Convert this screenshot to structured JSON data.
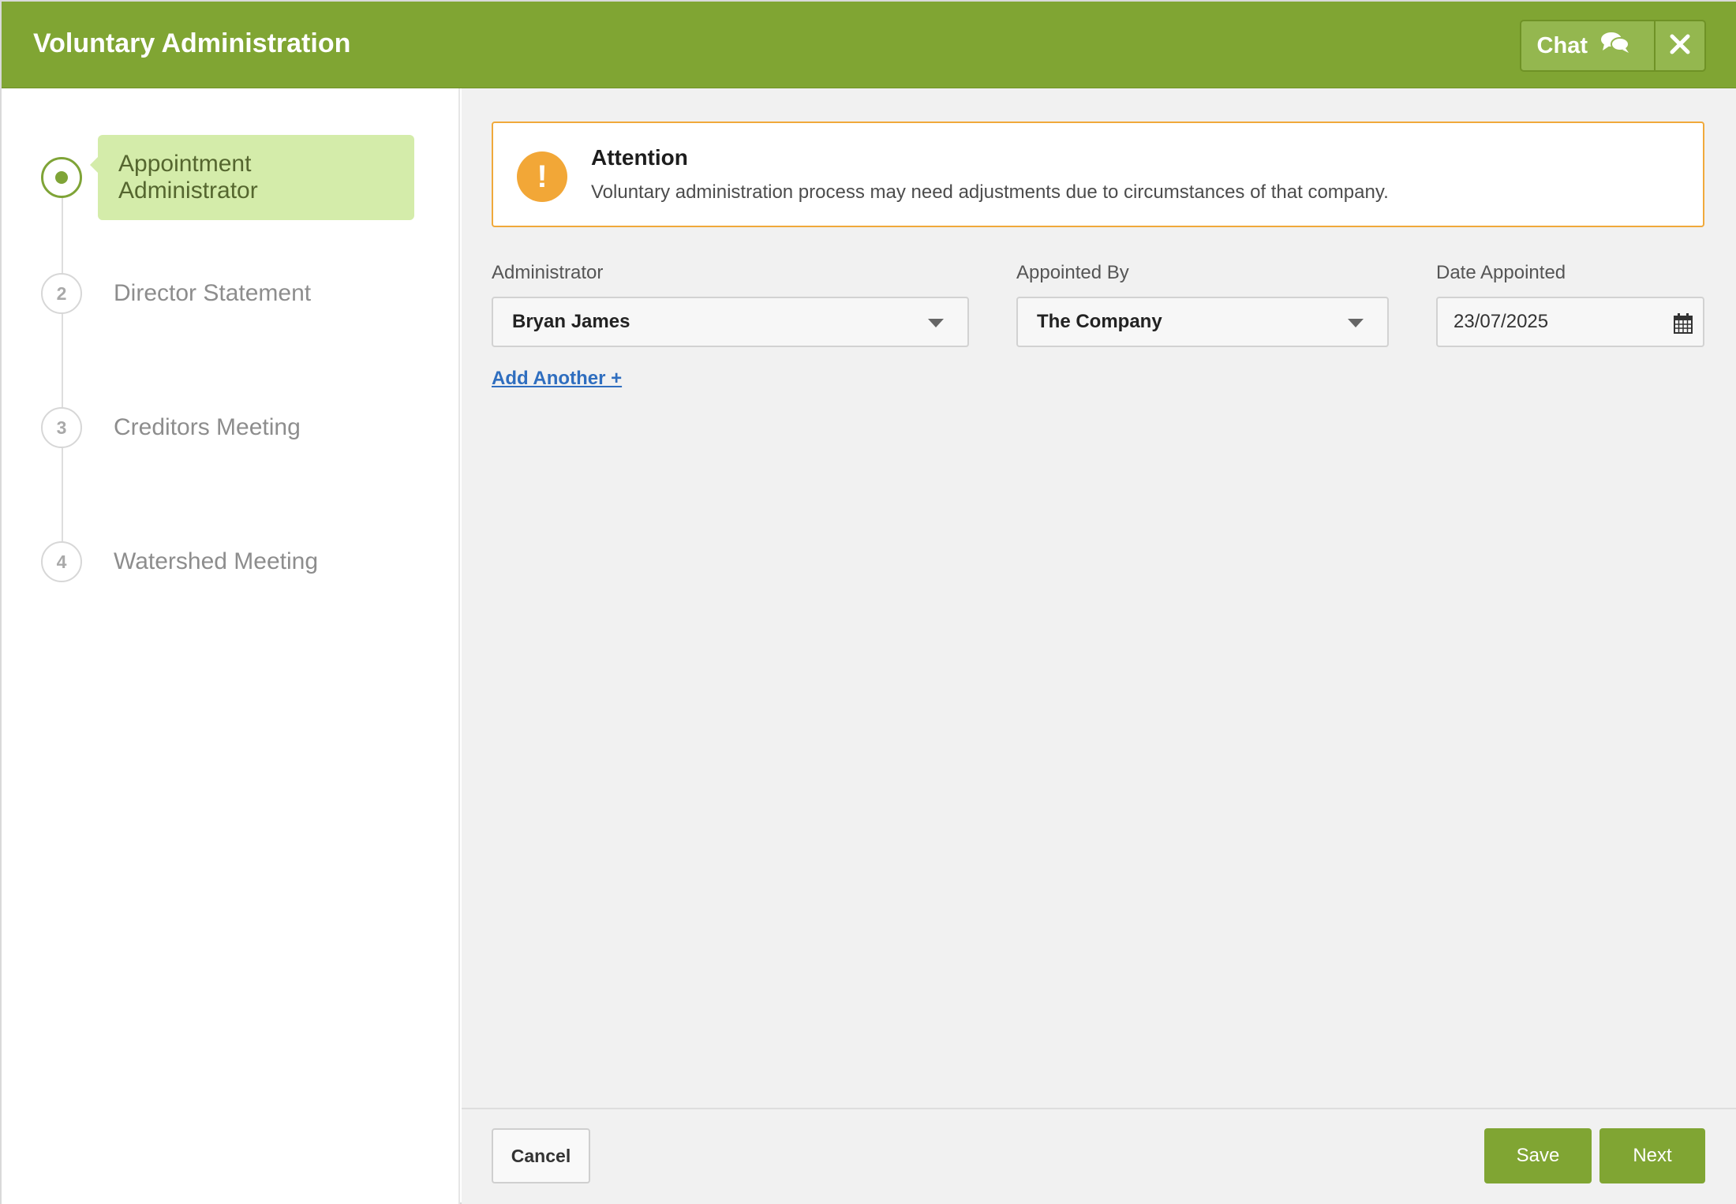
{
  "header": {
    "title": "Voluntary Administration",
    "chat_label": "Chat",
    "chat_icon": "chat-bubbles-icon",
    "close_icon": "close-icon"
  },
  "colors": {
    "brand_green": "#80a533",
    "active_step_bg": "#d4ecaa",
    "alert_orange": "#f2a737",
    "link_blue": "#2f6ebf"
  },
  "steps": [
    {
      "number": "",
      "label": "Appointment Administrator",
      "active": true
    },
    {
      "number": "2",
      "label": "Director Statement",
      "active": false
    },
    {
      "number": "3",
      "label": "Creditors Meeting",
      "active": false
    },
    {
      "number": "4",
      "label": "Watershed Meeting",
      "active": false
    }
  ],
  "alert": {
    "icon": "exclamation-icon",
    "title": "Attention",
    "message": "Voluntary administration process may need adjustments due to circumstances of that company."
  },
  "form": {
    "administrator": {
      "label": "Administrator",
      "value": "Bryan James"
    },
    "appointed_by": {
      "label": "Appointed By",
      "value": "The Company"
    },
    "date_appointed": {
      "label": "Date Appointed",
      "value": "23/07/2025"
    },
    "add_another": "Add Another +"
  },
  "footer": {
    "cancel": "Cancel",
    "save": "Save",
    "next": "Next"
  }
}
